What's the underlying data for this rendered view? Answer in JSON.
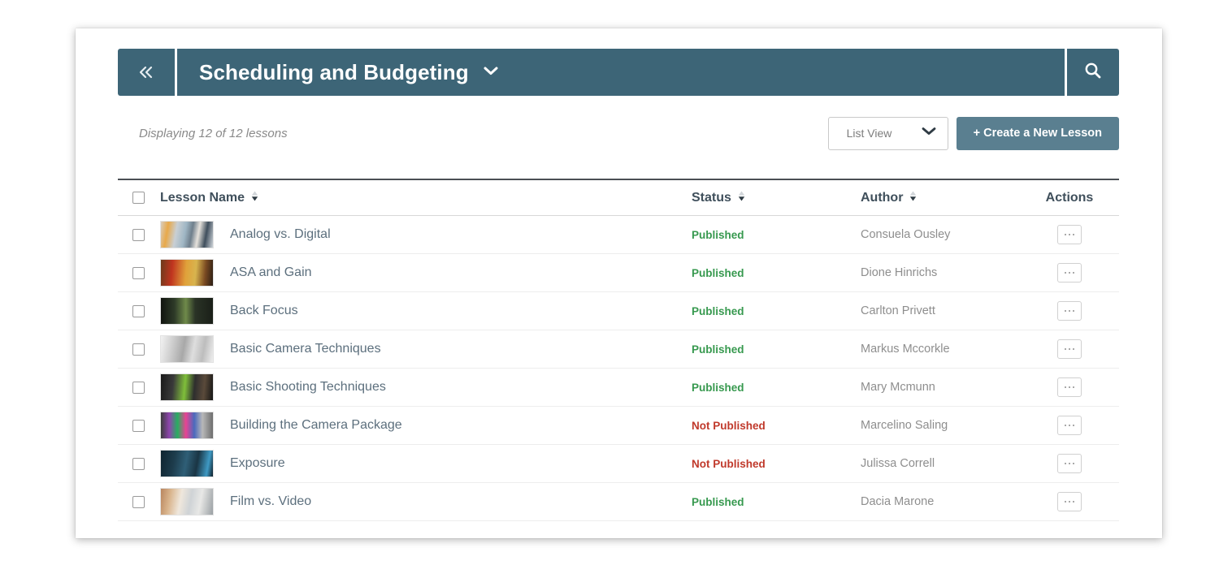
{
  "header": {
    "collapse_icon": "chevrons-left-icon",
    "title": "Scheduling and Budgeting",
    "title_caret_icon": "chevron-down-icon",
    "search_icon": "search-icon",
    "bar_color": "#3d6577"
  },
  "toolbar": {
    "count_text": "Displaying 12 of 12 lessons",
    "view_select": {
      "label": "List View",
      "caret_icon": "chevron-down-icon"
    },
    "create_button": "+ Create a New Lesson",
    "create_button_color": "#5a7f90"
  },
  "table": {
    "select_all_checkbox": "select-all-checkbox",
    "columns": [
      {
        "label": "Lesson Name",
        "sortable": true
      },
      {
        "label": "Status",
        "sortable": true
      },
      {
        "label": "Author",
        "sortable": true
      },
      {
        "label": "Actions",
        "sortable": false
      }
    ],
    "status_colors": {
      "published": "#37994f",
      "not_published": "#c0392b"
    },
    "row_action_icon": "ellipsis-icon",
    "rows": [
      {
        "name": "Analog vs. Digital",
        "status": "Published",
        "status_key": "published",
        "author": "Consuela Ousley",
        "thumb": "thumb-analog-vs-digital"
      },
      {
        "name": "ASA and Gain",
        "status": "Published",
        "status_key": "published",
        "author": "Dione Hinrichs",
        "thumb": "thumb-asa-and-gain"
      },
      {
        "name": "Back Focus",
        "status": "Published",
        "status_key": "published",
        "author": "Carlton Privett",
        "thumb": "thumb-back-focus"
      },
      {
        "name": "Basic Camera Techniques",
        "status": "Published",
        "status_key": "published",
        "author": "Markus Mccorkle",
        "thumb": "thumb-basic-camera"
      },
      {
        "name": "Basic Shooting Techniques",
        "status": "Published",
        "status_key": "published",
        "author": "Mary Mcmunn",
        "thumb": "thumb-basic-shooting"
      },
      {
        "name": "Building the Camera Package",
        "status": "Not Published",
        "status_key": "not_published",
        "author": "Marcelino Saling",
        "thumb": "thumb-building-package"
      },
      {
        "name": "Exposure",
        "status": "Not Published",
        "status_key": "not_published",
        "author": "Julissa Correll",
        "thumb": "thumb-exposure"
      },
      {
        "name": "Film vs. Video",
        "status": "Published",
        "status_key": "published",
        "author": "Dacia Marone",
        "thumb": "thumb-film-vs-video"
      }
    ]
  }
}
